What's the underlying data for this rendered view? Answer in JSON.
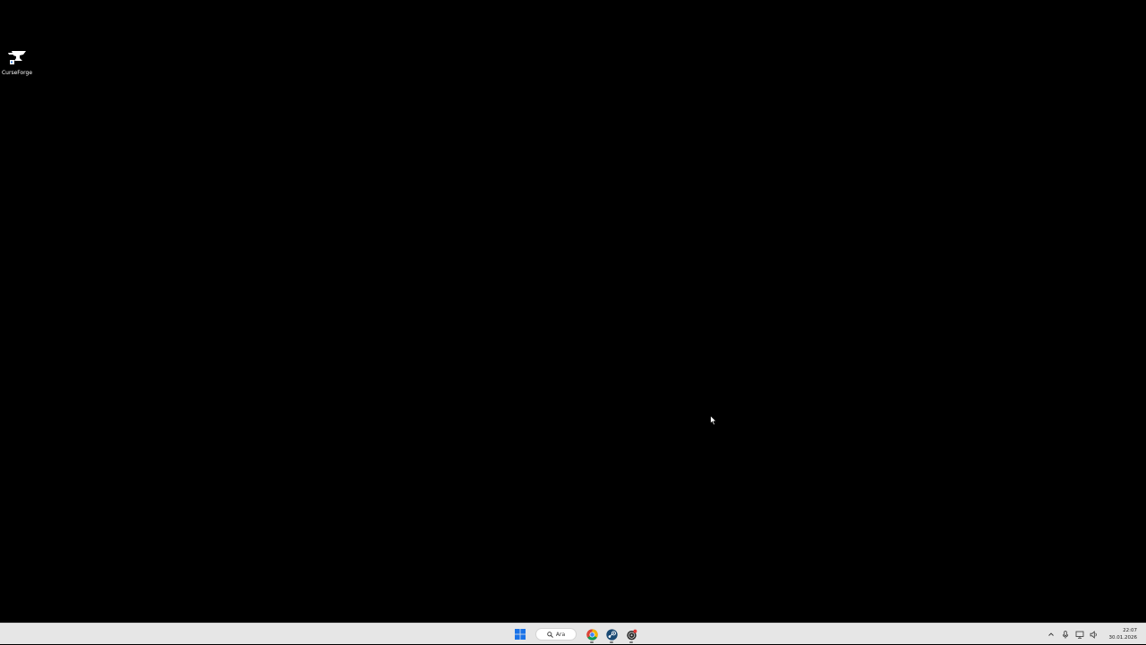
{
  "desktop": {
    "background_color": "#000000",
    "icons": [
      {
        "label": "CurseForge",
        "icon": "curseforge-anvil-icon"
      }
    ]
  },
  "taskbar": {
    "background_color": "#e6e6e6",
    "start_icon": "windows-start-icon",
    "search": {
      "label": "Ara",
      "icon": "search-icon"
    },
    "pinned_apps": [
      {
        "name": "chrome",
        "icon": "chrome-icon",
        "running": true
      },
      {
        "name": "steam",
        "icon": "steam-icon",
        "running": true
      },
      {
        "name": "app",
        "icon": "app-icon",
        "running": true
      }
    ],
    "tray": {
      "icons": [
        "chevron-up-icon",
        "microphone-icon",
        "network-icon",
        "speaker-icon"
      ],
      "time": "22:07",
      "date": "30.01.2026"
    }
  }
}
